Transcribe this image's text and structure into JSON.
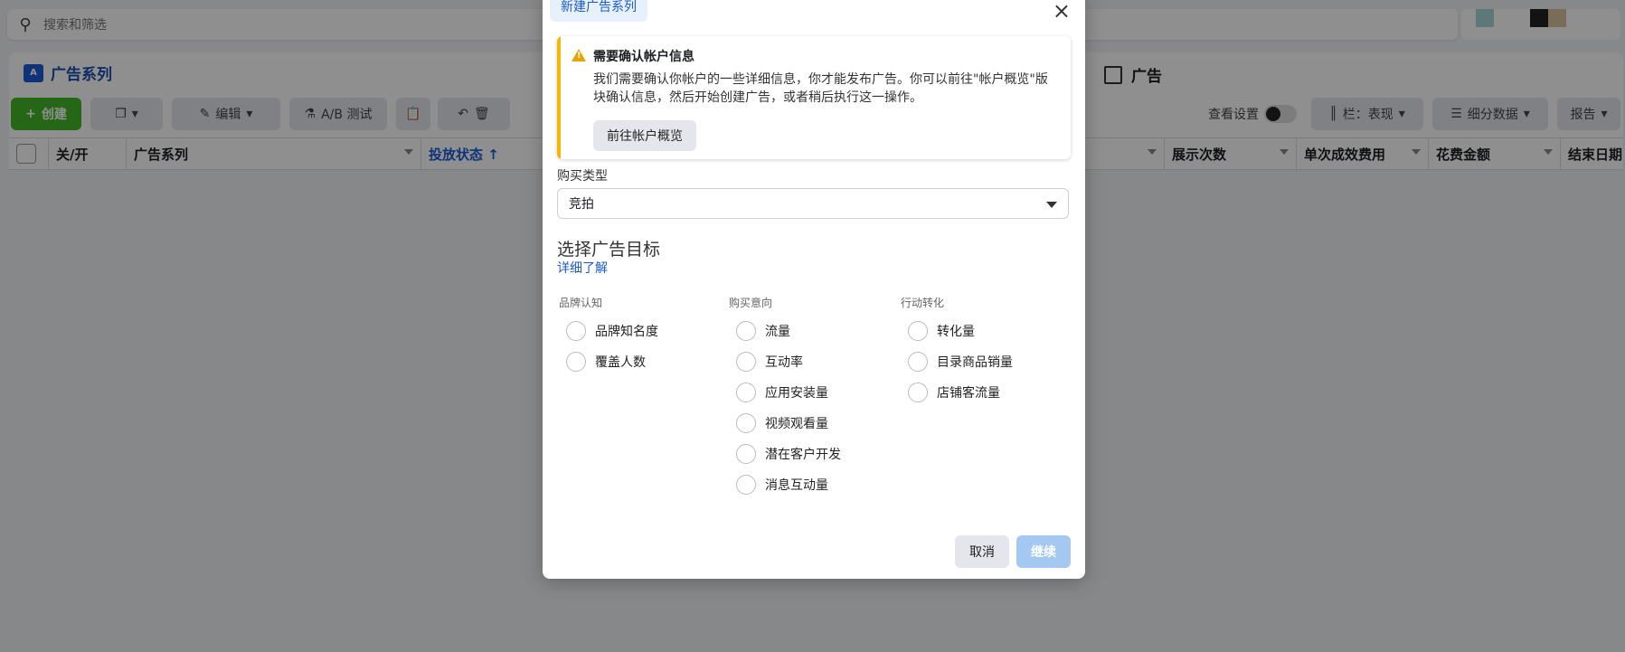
{
  "search": {
    "placeholder": "搜索和筛选"
  },
  "tabs": {
    "campaigns": "广告系列",
    "ads": "广告",
    "campaign_icon_letter": "A"
  },
  "toolbar": {
    "create": "创建",
    "edit": "编辑",
    "ab_test": "A/B 测试",
    "view_settings": "查看设置",
    "columns": "栏：表现",
    "breakdown": "细分数据",
    "reports": "报告"
  },
  "table": {
    "headers": [
      "关/开",
      "广告系列",
      "投放状态 ↑",
      "展示次数",
      "单次成效费用",
      "花费金额",
      "结束日期"
    ]
  },
  "modal": {
    "tab_label": "新建广告系列",
    "notice": {
      "title": "需要确认帐户信息",
      "text": "我们需要确认你帐户的一些详细信息，你才能发布广告。你可以前往\"帐户概览\"版块确认信息，然后开始创建广告，或者稍后执行这一操作。",
      "button": "前往帐户概览"
    },
    "buy_type_label": "购买类型",
    "buy_type_value": "竞拍",
    "section_title": "选择广告目标",
    "learn_more": "详细了解",
    "columns": [
      {
        "heading": "品牌认知",
        "options": [
          "品牌知名度",
          "覆盖人数"
        ]
      },
      {
        "heading": "购买意向",
        "options": [
          "流量",
          "互动率",
          "应用安装量",
          "视频观看量",
          "潜在客户开发",
          "消息互动量"
        ]
      },
      {
        "heading": "行动转化",
        "options": [
          "转化量",
          "目录商品销量",
          "店铺客流量"
        ]
      }
    ],
    "cancel": "取消",
    "continue": "继续"
  },
  "colors": {
    "accent": "#1a5bd8",
    "create_green": "#42b72a",
    "warning": "#f5b800",
    "continue_disabled": "#a5c8f3"
  }
}
